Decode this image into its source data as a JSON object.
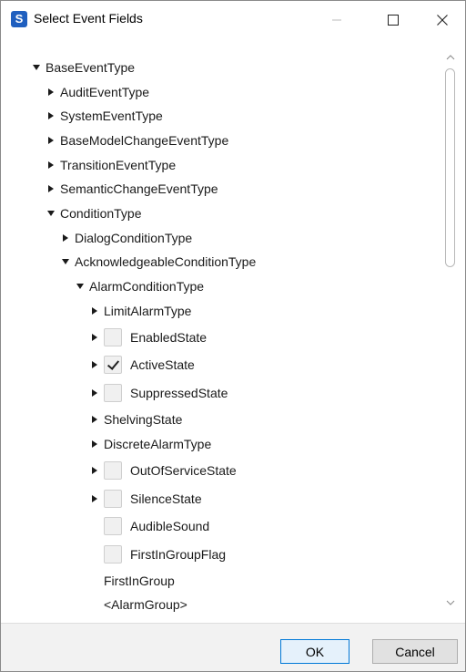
{
  "window": {
    "title": "Select Event Fields",
    "app_icon_letter": "S"
  },
  "tree": {
    "items": [
      {
        "label": "BaseEventType",
        "expanded": true,
        "checkbox": null
      },
      {
        "label": "AuditEventType",
        "expanded": false,
        "checkbox": null
      },
      {
        "label": "SystemEventType",
        "expanded": false,
        "checkbox": null
      },
      {
        "label": "BaseModelChangeEventType",
        "expanded": false,
        "checkbox": null
      },
      {
        "label": "TransitionEventType",
        "expanded": false,
        "checkbox": null
      },
      {
        "label": "SemanticChangeEventType",
        "expanded": false,
        "checkbox": null
      },
      {
        "label": "ConditionType",
        "expanded": true,
        "checkbox": null
      },
      {
        "label": "DialogConditionType",
        "expanded": false,
        "checkbox": null
      },
      {
        "label": "AcknowledgeableConditionType",
        "expanded": true,
        "checkbox": null
      },
      {
        "label": "AlarmConditionType",
        "expanded": true,
        "checkbox": null
      },
      {
        "label": "LimitAlarmType",
        "expanded": false,
        "checkbox": null
      },
      {
        "label": "EnabledState",
        "expanded": false,
        "checkbox": false
      },
      {
        "label": "ActiveState",
        "expanded": false,
        "checkbox": true
      },
      {
        "label": "SuppressedState",
        "expanded": false,
        "checkbox": false
      },
      {
        "label": "ShelvingState",
        "expanded": false,
        "checkbox": null
      },
      {
        "label": "DiscreteAlarmType",
        "expanded": false,
        "checkbox": null
      },
      {
        "label": "OutOfServiceState",
        "expanded": false,
        "checkbox": false
      },
      {
        "label": "SilenceState",
        "expanded": false,
        "checkbox": false
      },
      {
        "label": "AudibleSound",
        "expanded": null,
        "checkbox": false
      },
      {
        "label": "FirstInGroupFlag",
        "expanded": null,
        "checkbox": false
      },
      {
        "label": "FirstInGroup",
        "expanded": null,
        "checkbox": null
      },
      {
        "label": "<AlarmGroup>",
        "expanded": null,
        "checkbox": null
      }
    ]
  },
  "footer": {
    "ok_label": "OK",
    "cancel_label": "Cancel"
  },
  "colors": {
    "accent": "#0078d7",
    "footer_bg": "#f2f2f2"
  }
}
